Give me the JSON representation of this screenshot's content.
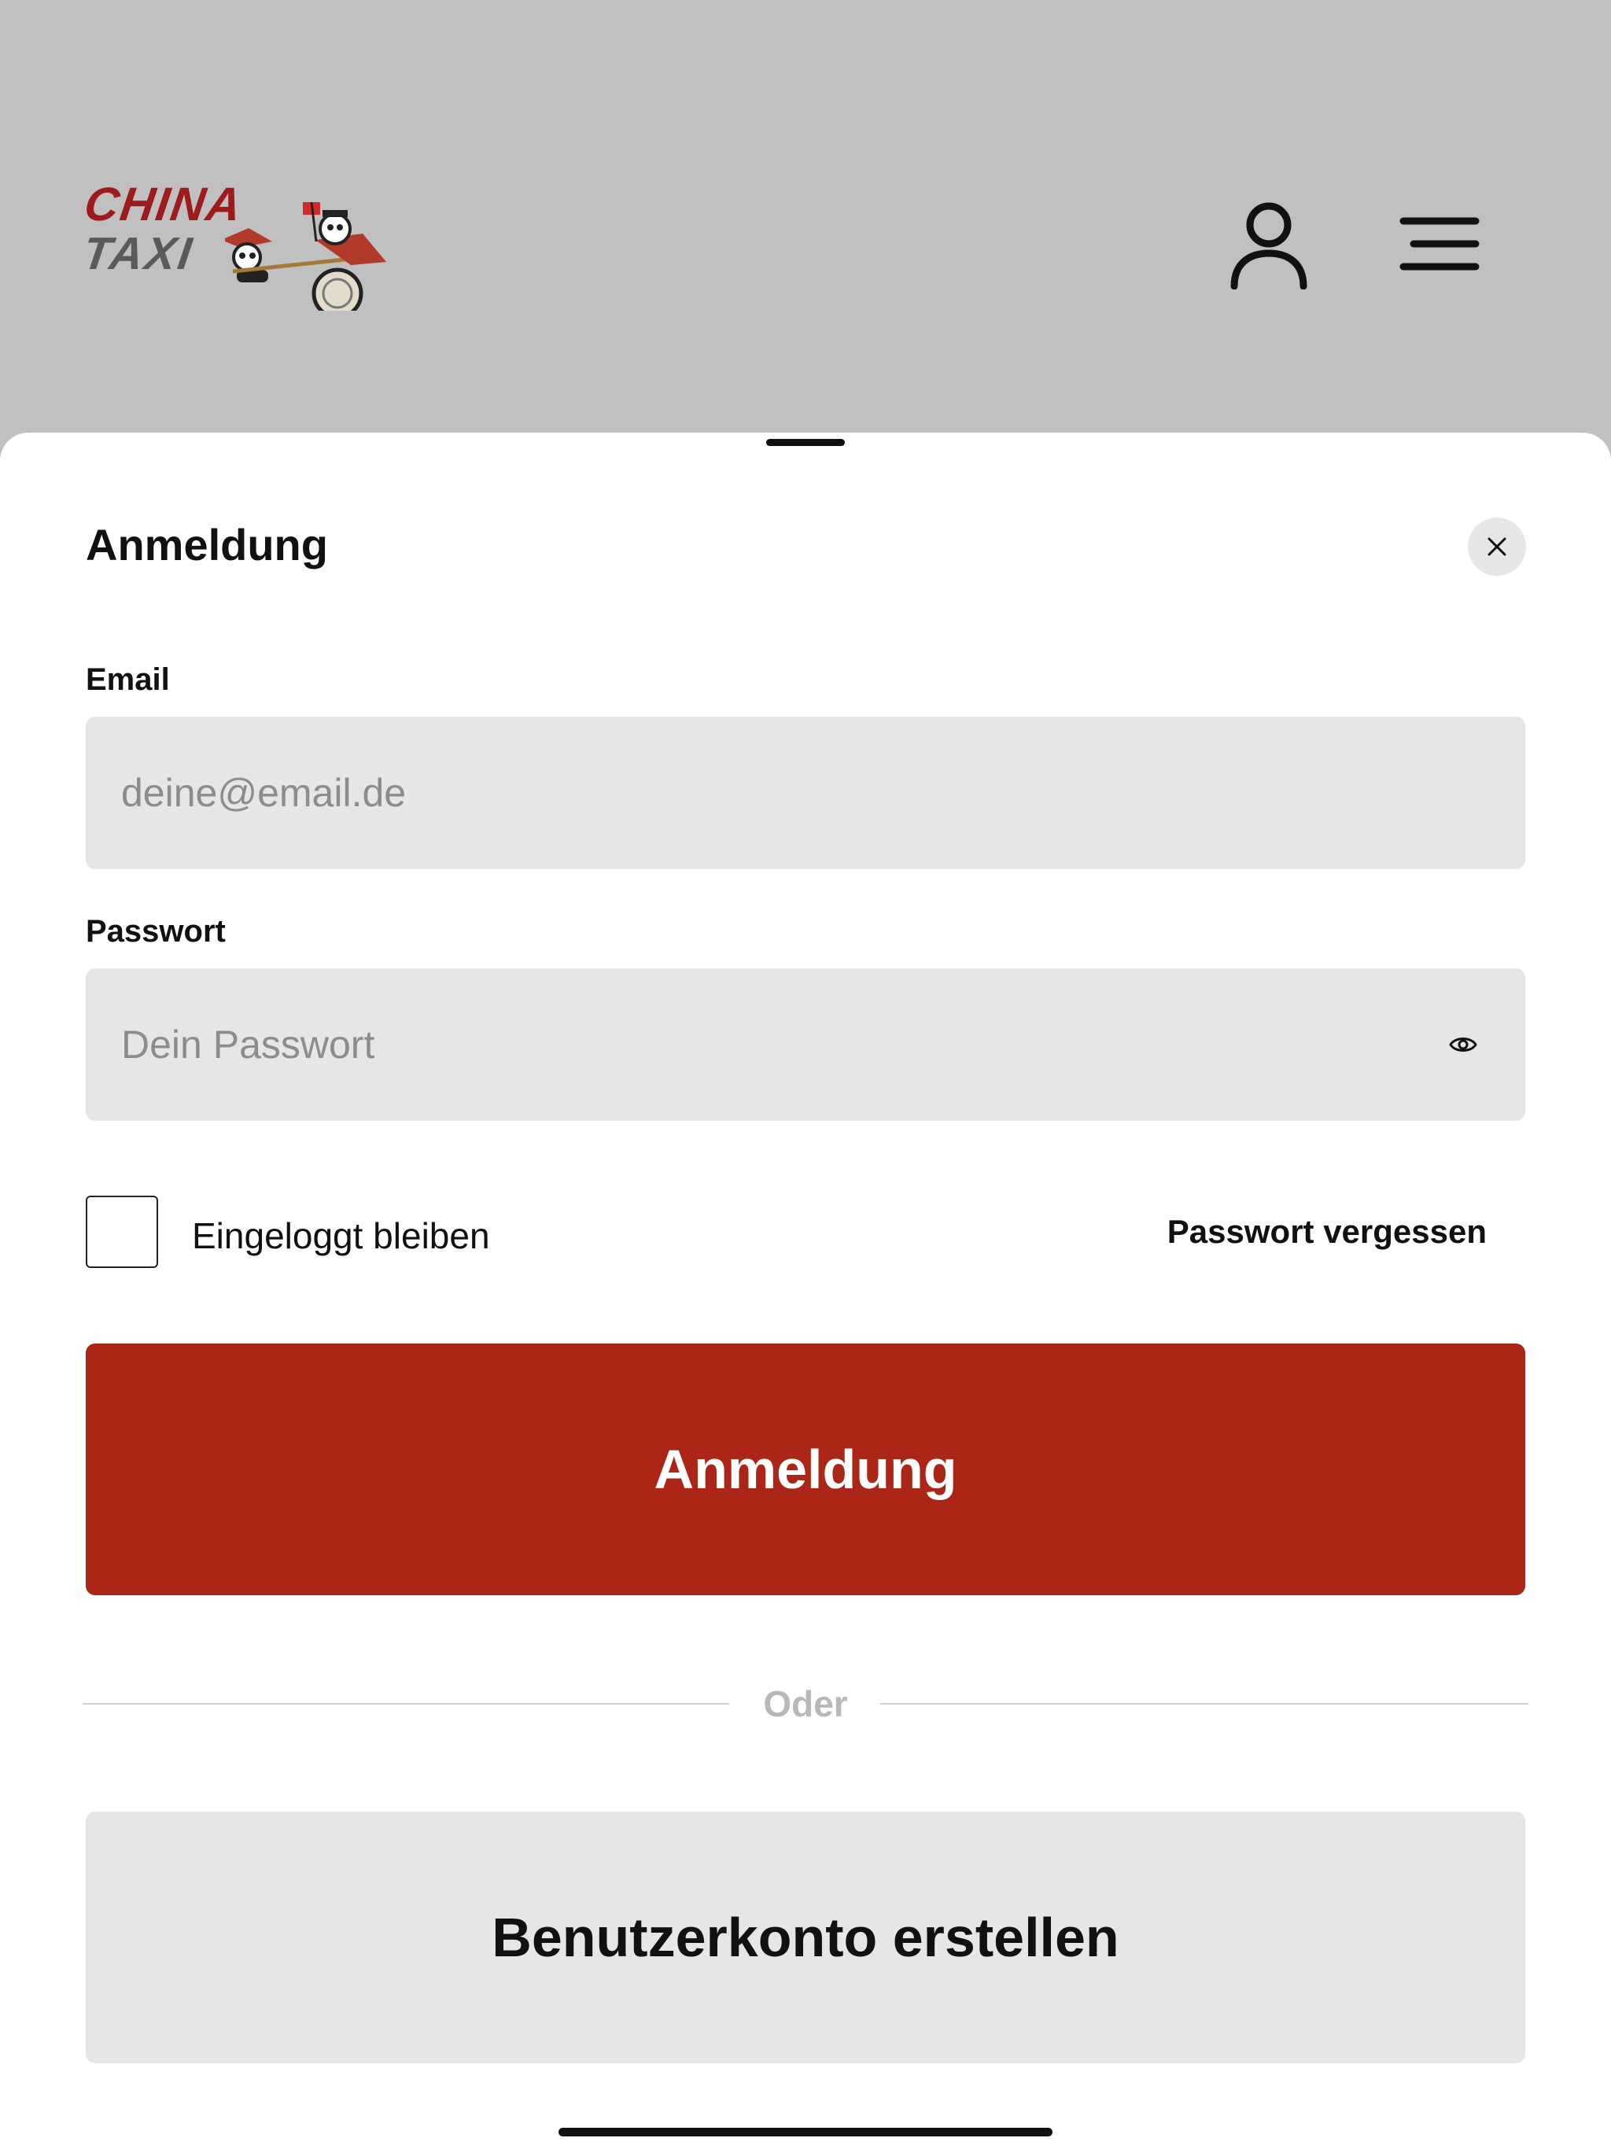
{
  "header": {
    "logo": {
      "line1": "CHINA",
      "line2": "TAXI"
    },
    "user_icon": "user-icon",
    "menu_icon": "menu-icon"
  },
  "login_sheet": {
    "title": "Anmeldung",
    "close_icon": "close-icon",
    "email": {
      "label": "Email",
      "placeholder": "deine@email.de",
      "value": ""
    },
    "password": {
      "label": "Passwort",
      "placeholder": "Dein Passwort",
      "value": "",
      "toggle_icon": "eye-icon"
    },
    "remember_me": {
      "label": "Eingeloggt bleiben",
      "checked": false
    },
    "forgot_password": "Passwort vergessen",
    "submit_label": "Anmeldung",
    "divider_text": "Oder",
    "register_label": "Benutzerkonto erstellen"
  },
  "colors": {
    "primary": "#ac2618",
    "header_bg": "#c0c0c0",
    "field_bg": "#e6e6e6",
    "logo_red": "#9e1b1b"
  }
}
